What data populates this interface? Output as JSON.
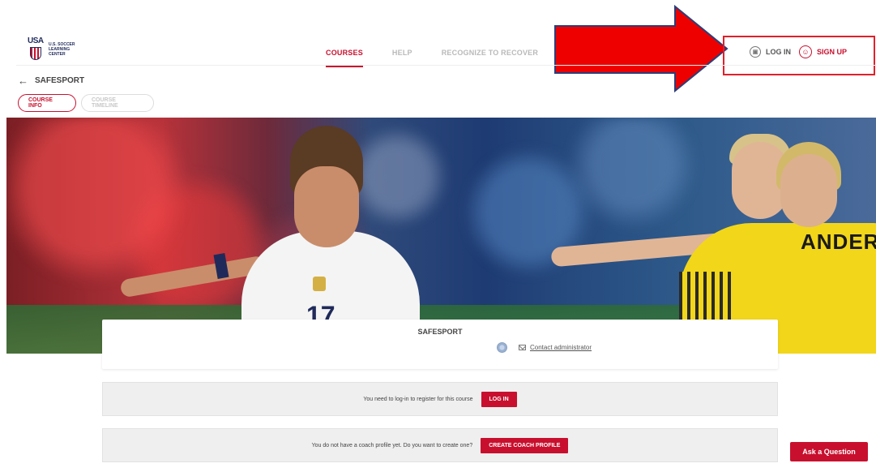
{
  "header": {
    "logo_line1": "U.S. SOCCER",
    "logo_line2": "LEARNING CENTER",
    "nav": [
      {
        "label": "COURSES"
      },
      {
        "label": "HELP"
      },
      {
        "label": "RECOGNIZE TO RECOVER"
      }
    ],
    "auth": {
      "login_label": "LOG IN",
      "signup_label": "SIGN UP"
    }
  },
  "page": {
    "back_title": "SAFESPORT",
    "tabs": [
      {
        "label": "COURSE INFO"
      },
      {
        "label": "COURSE TIMELINE"
      }
    ]
  },
  "hero": {
    "jersey_number": "17",
    "jersey_name": "ANDERS"
  },
  "course": {
    "title": "SAFESPORT",
    "contact_label": "Contact administrator"
  },
  "notices": [
    {
      "text": "You need to log-in to register for this course",
      "button": "LOG IN"
    },
    {
      "text": "You do not have a coach profile yet. Do you want to create one?",
      "button": "CREATE COACH PROFILE"
    }
  ],
  "ask_button": "Ask a Question",
  "colors": {
    "brand_red": "#c8102e",
    "annotation_red": "#e0202a",
    "navy": "#1f2a5a"
  }
}
